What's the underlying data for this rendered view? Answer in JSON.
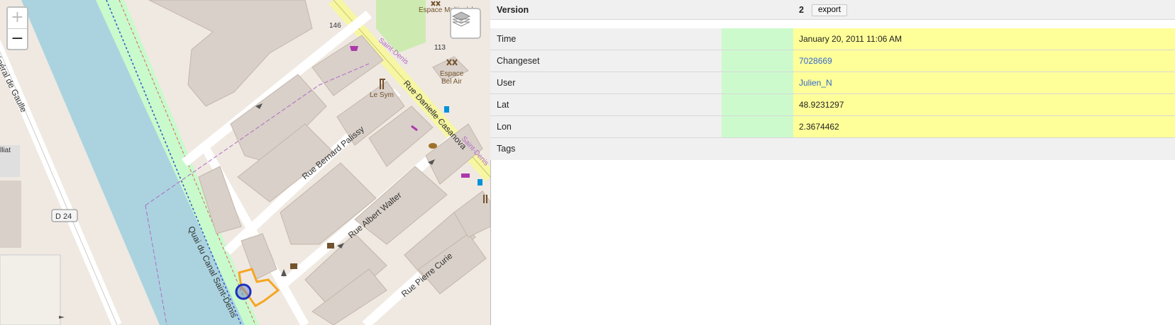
{
  "map": {
    "zoom_in_label": "+",
    "zoom_out_label": "−",
    "labels": {
      "num_146": "146",
      "num_113": "113",
      "espace_multimedia": "Espace Multiméd",
      "espace_bel_air_1": "Espace",
      "espace_bel_air_2": "Bel Air",
      "le_sym": "Le Sym",
      "rue_danielle": "Rue Danielle Casanova",
      "rue_bernard": "Rue Bernard Palissy",
      "rue_albert": "Rue Albert Walter",
      "rue_pierre": "Rue Pierre Curie",
      "quai": "Quai du Canal Saint-Denis",
      "general": "Général de Gaulle",
      "saint_denis": "Saint-Denis",
      "d24": "D 24",
      "liat": "lliat"
    },
    "icons": [
      "layers-icon",
      "restaurant-icon",
      "fast-food-icon",
      "bus-stop-icon",
      "shop-icon",
      "car-icon",
      "theatre-icon"
    ]
  },
  "details": {
    "header": {
      "label": "Version",
      "value": "2",
      "export_label": "export"
    },
    "rows": [
      {
        "label": "Time",
        "value": "January 20, 2011 11:06 AM"
      },
      {
        "label": "Changeset",
        "value": "7028669"
      },
      {
        "label": "User",
        "value": "Julien_N"
      },
      {
        "label": "Lat",
        "value": "48.9231297"
      },
      {
        "label": "Lon",
        "value": "2.3674462"
      }
    ],
    "tags_label": "Tags"
  },
  "colors": {
    "added_green": "#ccfacc",
    "value_yellow": "#ffff99",
    "link_blue": "#3366cc",
    "canal_blue": "#aad3df",
    "highlight_orange": "#f5a623"
  }
}
